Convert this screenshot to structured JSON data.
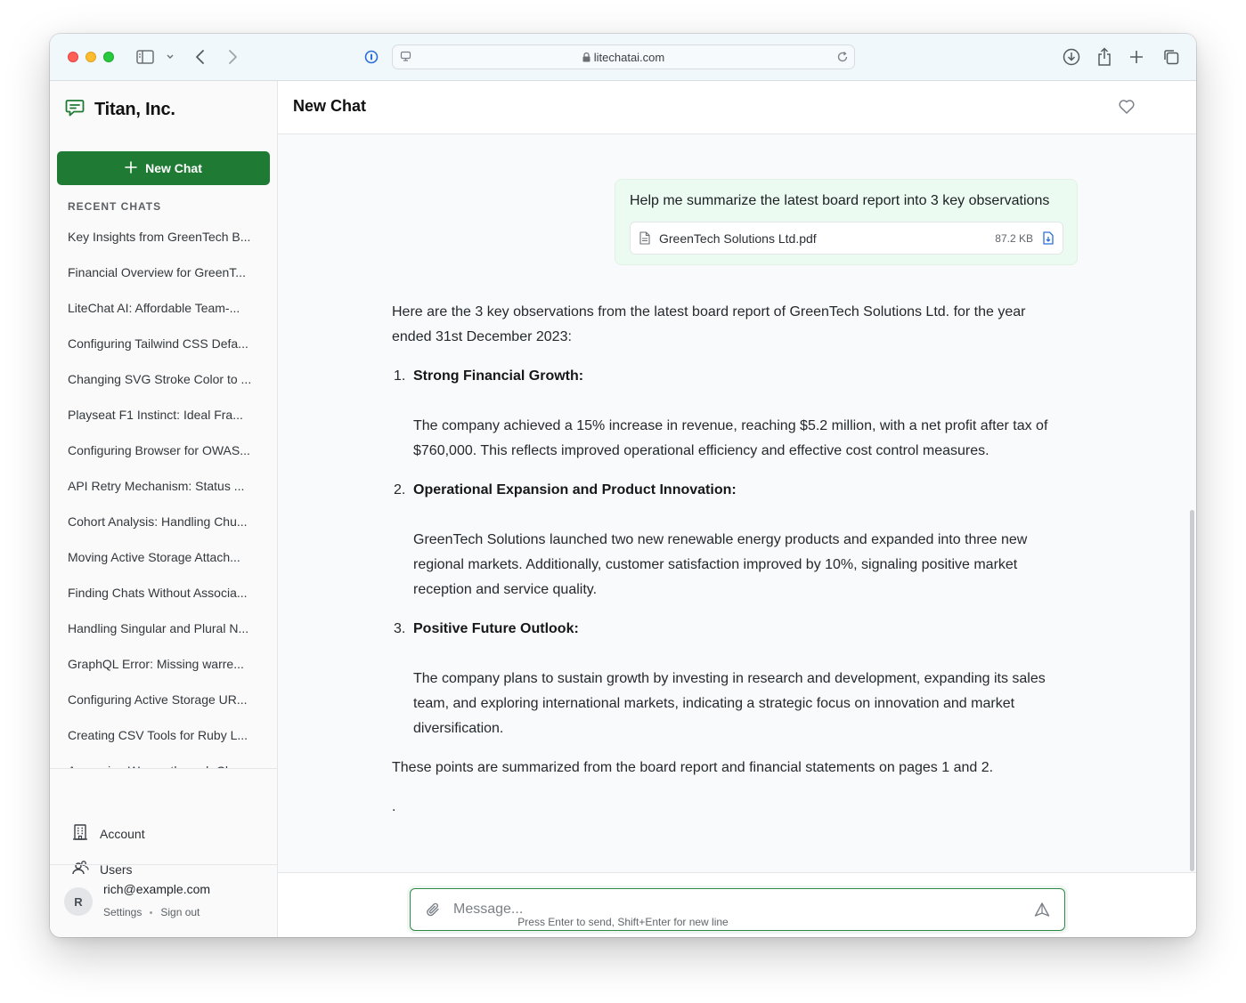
{
  "browser": {
    "url": "litechatai.com"
  },
  "sidebar": {
    "org_name": "Titan, Inc.",
    "new_chat_label": "New Chat",
    "recent_label": "RECENT CHATS",
    "recent_chats": [
      "Key Insights from GreenTech B...",
      "Financial Overview for GreenT...",
      "LiteChat AI: Affordable Team-...",
      "Configuring Tailwind CSS Defa...",
      "Changing SVG Stroke Color to ...",
      "Playseat F1 Instinct: Ideal Fra...",
      "Configuring Browser for OWAS...",
      "API Retry Mechanism: Status ...",
      "Cohort Analysis: Handling Chu...",
      "Moving Active Storage Attach...",
      "Finding Chats Without Associa...",
      "Handling Singular and Plural N...",
      "GraphQL Error: Missing warre...",
      "Configuring Active Storage UR...",
      "Creating CSV Tools for Ruby L...",
      "Accessing Wagon through Ch..."
    ],
    "nav": {
      "account": "Account",
      "users": "Users"
    },
    "user": {
      "initial": "R",
      "email": "rich@example.com",
      "settings": "Settings",
      "sign_out": "Sign out"
    }
  },
  "chat": {
    "title": "New Chat",
    "user_message": "Help me summarize the latest board report into 3 key observations",
    "attachment": {
      "name": "GreenTech Solutions Ltd.pdf",
      "size": "87.2 KB"
    },
    "reply": {
      "intro": "Here are the 3 key observations from the latest board report of GreenTech Solutions Ltd. for the year ended 31st December 2023:",
      "points": [
        {
          "num": "1.",
          "heading": "Strong Financial Growth:",
          "body": "The company achieved a 15% increase in revenue, reaching $5.2 million, with a net profit after tax of $760,000. This reflects improved operational efficiency and effective cost control measures."
        },
        {
          "num": "2.",
          "heading": "Operational Expansion and Product Innovation:",
          "body": "GreenTech Solutions launched two new renewable energy products and expanded into three new regional markets. Additionally, customer satisfaction improved by 10%, signaling positive market reception and service quality."
        },
        {
          "num": "3.",
          "heading": "Positive Future Outlook:",
          "body": "The company plans to sustain growth by investing in research and development, expanding its sales team, and exploring international markets, indicating a strategic focus on innovation and market diversification."
        }
      ],
      "outro": "These points are summarized from the board report and financial statements on pages 1 and 2.",
      "tail": "."
    }
  },
  "composer": {
    "placeholder": "Message...",
    "hint": "Press Enter to send, Shift+Enter for new line"
  },
  "colors": {
    "accent": "#1f7a34",
    "user_bubble": "#ecfbf1"
  }
}
